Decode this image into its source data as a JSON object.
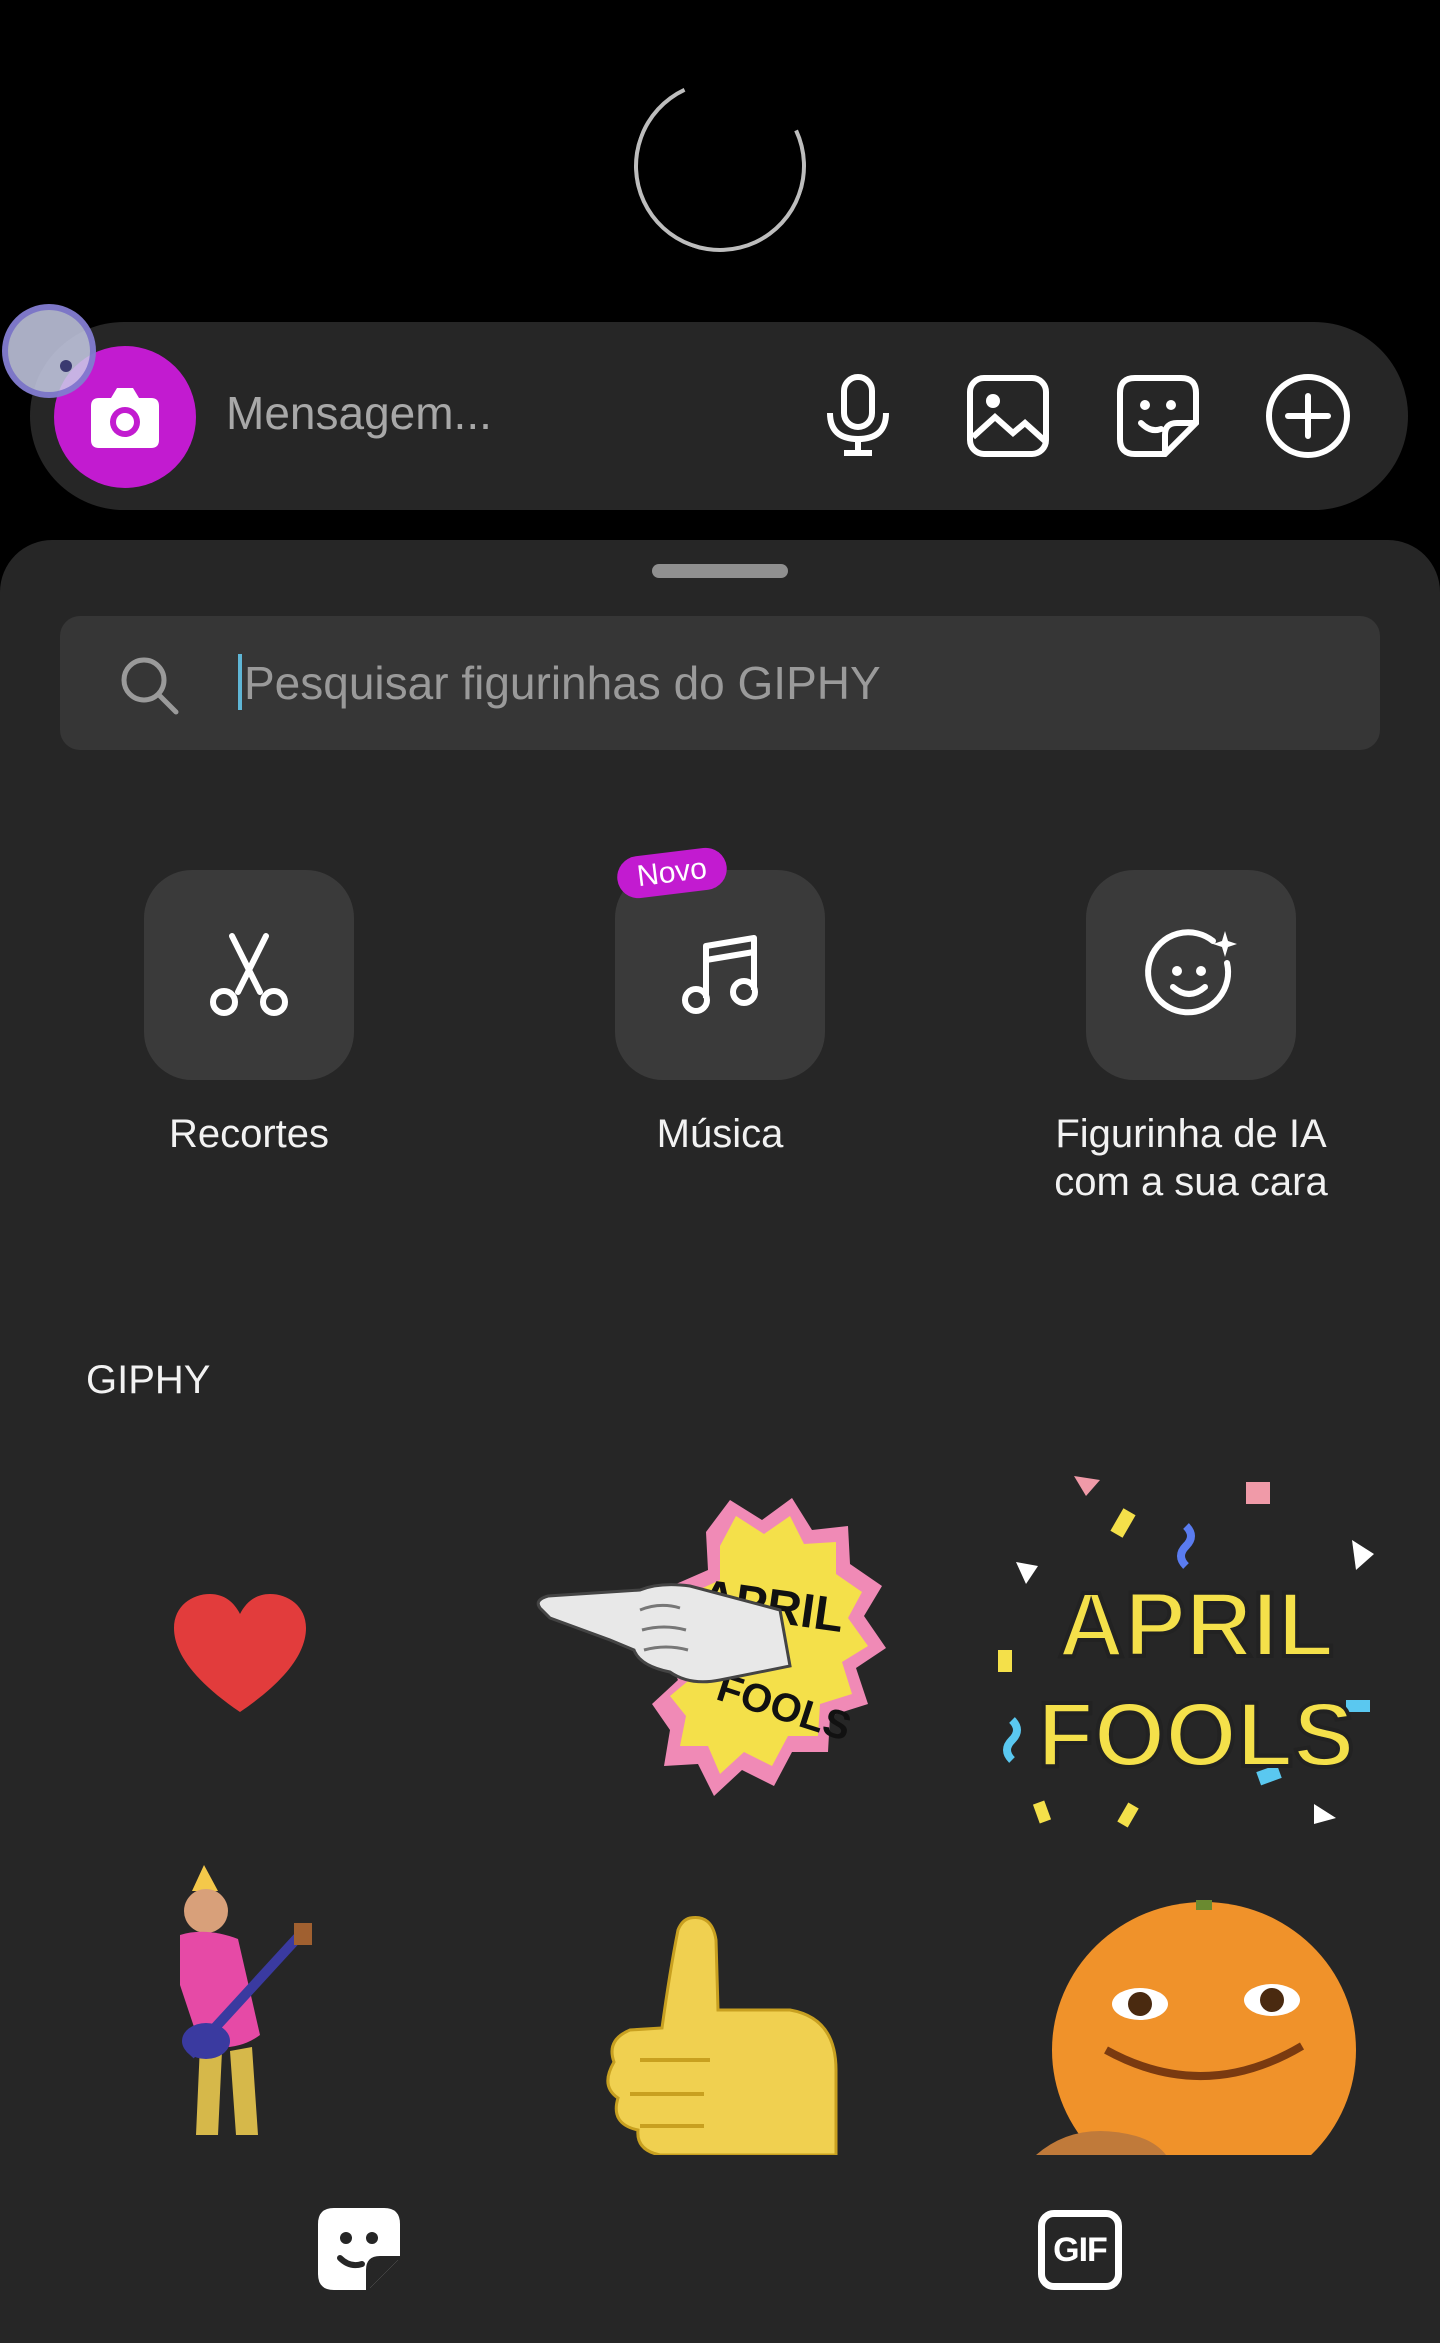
{
  "composer": {
    "placeholder": "Mensagem...",
    "icons": [
      "camera-icon",
      "microphone-icon",
      "gallery-icon",
      "sticker-icon",
      "add-icon"
    ],
    "camera_color": "#c21bd0"
  },
  "sticker_tray": {
    "search_placeholder": "Pesquisar figurinhas do GIPHY",
    "tools": [
      {
        "label": "Recortes",
        "icon": "scissors-icon"
      },
      {
        "label": "Música",
        "icon": "music-note-icon",
        "badge": "Novo"
      },
      {
        "label": "Figurinha de IA com a sua cara",
        "icon": "ai-smiley-icon"
      }
    ],
    "section_title": "GIPHY",
    "stickers": [
      {
        "name": "heart-sticker"
      },
      {
        "name": "april-fools-pointing-sticker",
        "text_top": "APRIL",
        "text_bottom": "FOOLS"
      },
      {
        "name": "april-fools-confetti-sticker",
        "text_top": "APRIL",
        "text_bottom": "FOOLS"
      },
      {
        "name": "guitar-party-sticker"
      },
      {
        "name": "thumbs-up-sticker"
      },
      {
        "name": "orange-face-sticker"
      }
    ]
  },
  "tabs": [
    {
      "icon": "sticker-tab-icon"
    },
    {
      "label": "GIF",
      "icon": "gif-tab-icon"
    }
  ]
}
